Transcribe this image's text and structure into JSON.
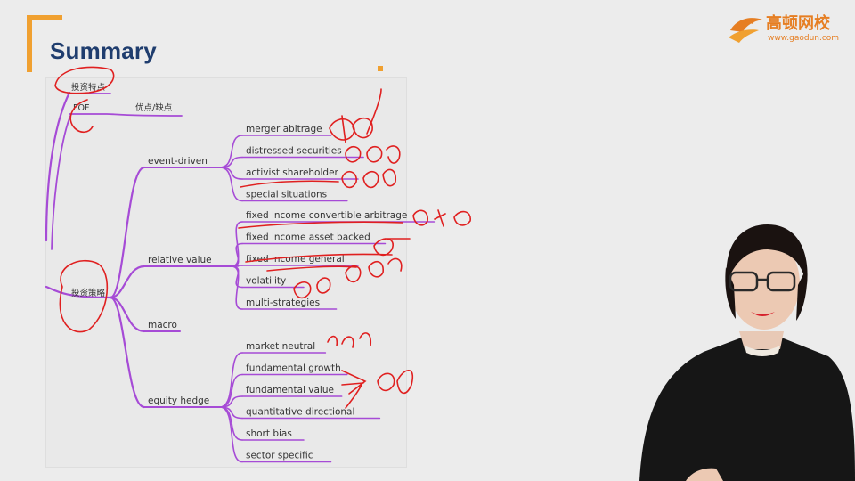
{
  "slide": {
    "title": "Summary",
    "logo": {
      "name": "高顿网校",
      "url": "www.gaodun.com",
      "icon": "bird-logo-icon",
      "color": "#e67e22"
    },
    "accent_color": "#f0a030",
    "title_color": "#1f3d6e",
    "branch_color": "#a64bd6",
    "annotation_color": "#e02020"
  },
  "mindmap": {
    "top_nodes": [
      {
        "id": "features",
        "label": "投资特点"
      },
      {
        "id": "fof",
        "label": "FOF"
      },
      {
        "id": "pros_cons",
        "label": "优点/缺点"
      }
    ],
    "root": {
      "label": "投资策略"
    },
    "categories": [
      {
        "label": "event-driven",
        "items": [
          "merger abitrage",
          "distressed securities",
          "activist shareholder",
          "special situations"
        ]
      },
      {
        "label": "relative value",
        "items": [
          "fixed income convertible arbitrage",
          "fixed income asset backed",
          "fixed income general",
          "volatility",
          "multi-strategies"
        ]
      },
      {
        "label": "macro",
        "items": []
      },
      {
        "label": "equity hedge",
        "items": [
          "market neutral",
          "fundamental growth",
          "fundamental value",
          "quantitative directional",
          "short bias",
          "sector specific"
        ]
      }
    ]
  }
}
